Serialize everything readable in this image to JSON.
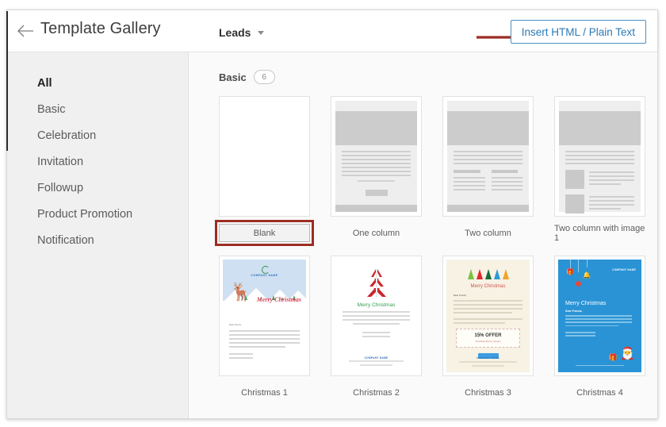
{
  "header": {
    "back_label": "back-arrow",
    "title": "Template Gallery",
    "module": "Leads",
    "insert_button": "Insert HTML / Plain Text"
  },
  "annotation": {
    "color": "#9c2d22",
    "arrow_target": "Insert HTML / Plain Text",
    "box_target": "Blank"
  },
  "sidebar": {
    "items": [
      {
        "label": "All",
        "active": true
      },
      {
        "label": "Basic",
        "active": false
      },
      {
        "label": "Celebration",
        "active": false
      },
      {
        "label": "Invitation",
        "active": false
      },
      {
        "label": "Followup",
        "active": false
      },
      {
        "label": "Product Promotion",
        "active": false
      },
      {
        "label": "Notification",
        "active": false
      }
    ]
  },
  "section": {
    "title": "Basic",
    "count": "6"
  },
  "templates": [
    {
      "label": "Blank",
      "kind": "blank",
      "selected": true
    },
    {
      "label": "One column",
      "kind": "one-column",
      "selected": false
    },
    {
      "label": "Two column",
      "kind": "two-column",
      "selected": false
    },
    {
      "label": "Two column with image 1",
      "kind": "two-column-image",
      "selected": false
    },
    {
      "label": "Christmas 1",
      "kind": "christmas-1",
      "selected": false
    },
    {
      "label": "Christmas 2",
      "kind": "christmas-2",
      "selected": false
    },
    {
      "label": "Christmas 3",
      "kind": "christmas-3",
      "selected": false
    },
    {
      "label": "Christmas 4",
      "kind": "christmas-4",
      "selected": false
    }
  ],
  "thumb_text": {
    "company_name": "COMPANY NAME",
    "merry_christmas": "Merry Christmas",
    "dear_greeting": "Dear Friend,",
    "offer_amount": "15% OFFER",
    "offer_sub": "Christmas Promo Coupon",
    "c4_dear": "Dear Francis,"
  },
  "colors": {
    "accent_blue": "#2b79b5",
    "annotation_red": "#9c2d22",
    "sidebar_bg": "#f0f0f0",
    "content_bg": "#fafafa",
    "xmas4_bg": "#2a93d5",
    "xmas3_bg": "#f7f2e4"
  }
}
